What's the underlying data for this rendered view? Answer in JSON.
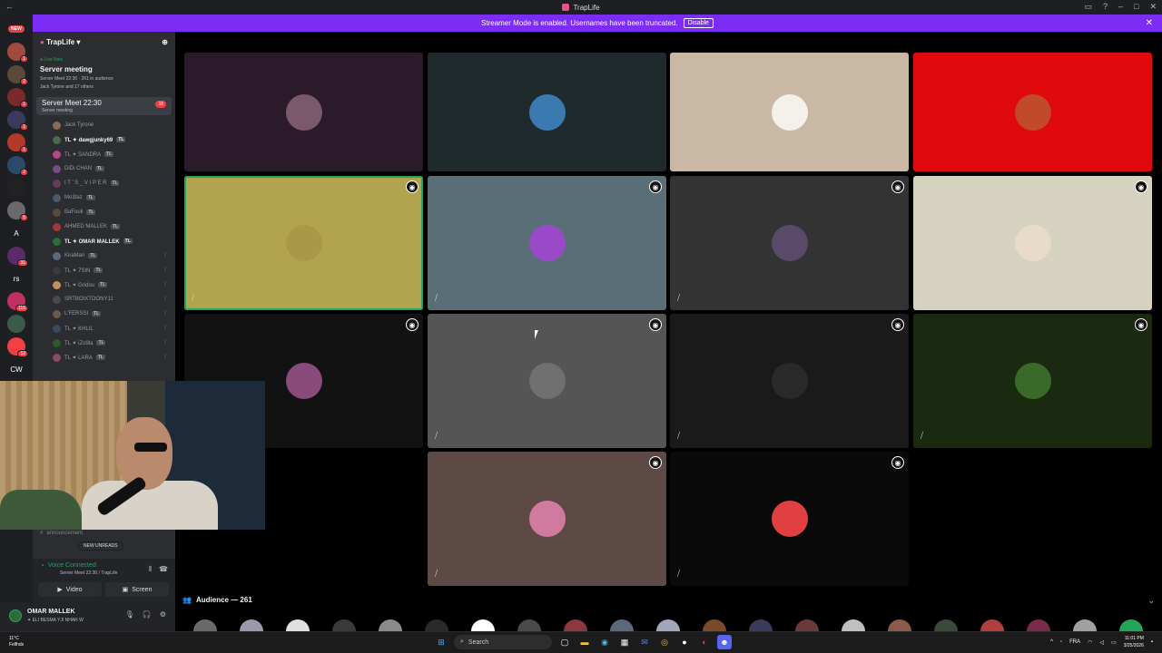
{
  "window": {
    "title": "TrapLife"
  },
  "banner": {
    "text": "Streamer Mode is enabled. Usernames have been truncated.",
    "disable_label": "Disable"
  },
  "guilds": [
    {
      "color": "#f23f43",
      "label": "NEW",
      "badge": ""
    },
    {
      "color": "#a14b3f",
      "label": "",
      "badge": "1"
    },
    {
      "color": "#5a4a3a",
      "label": "",
      "badge": "2"
    },
    {
      "color": "#7a2a2a",
      "label": "",
      "badge": "1"
    },
    {
      "color": "#3a3a5a",
      "label": "",
      "badge": "1"
    },
    {
      "color": "#b33a2a",
      "label": "",
      "badge": "1"
    },
    {
      "color": "#2a4a6a",
      "label": "",
      "badge": "2"
    },
    {
      "color": "#222",
      "label": "",
      "badge": ""
    },
    {
      "color": "#6a6a6a",
      "label": "",
      "badge": "5"
    },
    {
      "color": "#1e1f22",
      "label": "A",
      "badge": ""
    },
    {
      "color": "#5a2a6a",
      "label": "",
      "badge": "31"
    },
    {
      "color": "#1e1f22",
      "label": "rs",
      "badge": ""
    },
    {
      "color": "#c03060",
      "label": "",
      "badge": "116"
    },
    {
      "color": "#3a5a4a",
      "label": "",
      "badge": ""
    },
    {
      "color": "#f23f43",
      "label": "",
      "badge": "12"
    },
    {
      "color": "#1e1f22",
      "label": "CW",
      "badge": ""
    }
  ],
  "server": {
    "name": "TrapLife",
    "live_label": "Live Now",
    "event_title": "Server meeting",
    "event_sub1": "Server Meet 22:30 · 261 in audience",
    "event_sub2": "Jack Tyrone and 17 others",
    "stage_name": "Server Meet 22:30",
    "stage_sub": "Server meeting",
    "stage_count": "18"
  },
  "members": [
    {
      "name": "Jack Tyrone",
      "tl": "",
      "color": "#8a6a5a",
      "bold": false,
      "mic": false
    },
    {
      "name": "TL ✦ dawgjunky69",
      "tl": "TL",
      "color": "#4a6a4a",
      "bold": true,
      "mic": false
    },
    {
      "name": "TL ✦ SANDRA",
      "tl": "TL",
      "color": "#b04a8a",
      "bold": false,
      "mic": false
    },
    {
      "name": "DiDi CHAN",
      "tl": "TL",
      "color": "#7a4a8a",
      "bold": false,
      "mic": false
    },
    {
      "name": "I T ' S _ V I P E R",
      "tl": "TL",
      "color": "#6a3a5a",
      "bold": false,
      "mic": false
    },
    {
      "name": "Mo3taz",
      "tl": "TL",
      "color": "#4a5a6a",
      "bold": false,
      "mic": false
    },
    {
      "name": "BaFouli",
      "tl": "TL",
      "color": "#5a4a3a",
      "bold": false,
      "mic": false
    },
    {
      "name": "AHMED MALLEK",
      "tl": "TL",
      "color": "#a03a3a",
      "bold": false,
      "mic": false
    },
    {
      "name": "TL ✦ OMAR MALLEK",
      "tl": "TL",
      "color": "#2f6b3a",
      "bold": true,
      "mic": false
    },
    {
      "name": "KiraMan",
      "tl": "TL",
      "color": "#5a6a7a",
      "bold": false,
      "mic": true
    },
    {
      "name": "TL ✦ 7SIN",
      "tl": "TL",
      "color": "#3a3a3a",
      "bold": false,
      "mic": true
    },
    {
      "name": "TL ✦ Gridou",
      "tl": "TL",
      "color": "#c09060",
      "bold": false,
      "mic": true
    },
    {
      "name": "SRTBOIXTOONY11",
      "tl": "",
      "color": "#4a4a4a",
      "bold": false,
      "mic": true
    },
    {
      "name": "L'FERSSI",
      "tl": "TL",
      "color": "#6a5a4a",
      "bold": false,
      "mic": true
    },
    {
      "name": "TL ✦ KHLIL",
      "tl": "",
      "color": "#3a4a5a",
      "bold": false,
      "mic": true
    },
    {
      "name": "TL ✦ iZo9la",
      "tl": "TL",
      "color": "#2a5a2a",
      "bold": false,
      "mic": true
    },
    {
      "name": "TL ✦ LARA",
      "tl": "TL",
      "color": "#8a4a6a",
      "bold": false,
      "mic": true
    }
  ],
  "channels": {
    "announcement": "announcement",
    "new_unreads": "NEW UNREADS"
  },
  "voice": {
    "status": "Voice Connected",
    "location": "Server Meet 22:30 / TrapLife",
    "video_label": "Video",
    "screen_label": "Screen"
  },
  "user": {
    "name": "OMAR MALLEK",
    "status": "✦ ELI BESMA YJI NHAR W"
  },
  "tiles": [
    {
      "bg": "#2a1a2a",
      "av": "#7a5a6a",
      "speaker": true,
      "mute": false,
      "hl": false
    },
    {
      "bg": "#1f2a2c",
      "av": "#3a7ab0",
      "speaker": true,
      "mute": false,
      "hl": false
    },
    {
      "bg": "#c8b8a4",
      "av": "#f4f0ea",
      "speaker": true,
      "mute": false,
      "hl": false
    },
    {
      "bg": "#e00a0e",
      "av": "#c04a2a",
      "speaker": true,
      "mute": false,
      "hl": false
    },
    {
      "bg": "#b2a44e",
      "av": "#a89848",
      "speaker": true,
      "mute": true,
      "hl": true
    },
    {
      "bg": "#5a6e78",
      "av": "#9a4ac8",
      "speaker": true,
      "mute": true,
      "hl": false
    },
    {
      "bg": "#333333",
      "av": "#5a4a6a",
      "speaker": true,
      "mute": true,
      "hl": false
    },
    {
      "bg": "#d6d2c0",
      "av": "#e8dcc8",
      "speaker": true,
      "mute": true,
      "hl": false
    },
    {
      "bg": "#121212",
      "av": "#8a4a7a",
      "speaker": true,
      "mute": false,
      "hl": false
    },
    {
      "bg": "#555555",
      "av": "#707070",
      "speaker": true,
      "mute": true,
      "hl": false
    },
    {
      "bg": "#1a1a1a",
      "av": "#2a2a2a",
      "speaker": true,
      "mute": true,
      "hl": false
    },
    {
      "bg": "#1a2a10",
      "av": "#3a6a2a",
      "speaker": true,
      "mute": true,
      "hl": false
    },
    {
      "bg": "#5e4a44",
      "av": "#d07aa0",
      "speaker": true,
      "mute": true,
      "hl": false
    },
    {
      "bg": "#0a0a0a",
      "av": "#e04040",
      "speaker": true,
      "mute": true,
      "hl": false
    }
  ],
  "audience": {
    "label": "Audience — 261"
  },
  "audience_colors": [
    "#6a6a6a",
    "#9a9aaa",
    "#e0e0e0",
    "#3a3a3a",
    "#8a8a8a",
    "#2a2a2a",
    "#ffffff",
    "#4a4a4a",
    "#8a3a3a",
    "#5a6a7a",
    "#a0a8b8",
    "#7a4a2a",
    "#3a3a5a",
    "#6a3a3a",
    "#c0c0c0",
    "#8a5a4a",
    "#3a4a3a",
    "#b04040",
    "#7a2a4a",
    "#a0a0a0",
    "#23a55a"
  ],
  "taskbar": {
    "weather_temp": "11°C",
    "weather_cond": "Fellhds",
    "search": "Search",
    "lang": "FRA",
    "time": "11:01 PM",
    "date": "3/25/2026"
  }
}
